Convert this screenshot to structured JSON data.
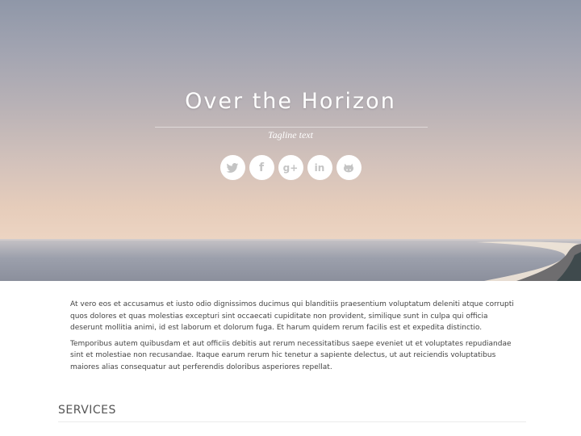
{
  "hero": {
    "title": "Over the Horizon",
    "tagline": "Tagline text",
    "social": [
      {
        "icon": "twitter-icon"
      },
      {
        "icon": "facebook-icon",
        "glyph": "f"
      },
      {
        "icon": "google-plus-icon",
        "glyph": "g+"
      },
      {
        "icon": "linkedin-icon",
        "glyph": "in"
      },
      {
        "icon": "github-icon"
      }
    ]
  },
  "content": {
    "paragraphs": [
      "At vero eos et accusamus et iusto odio dignissimos ducimus qui blanditiis praesentium voluptatum deleniti atque corrupti quos dolores et quas molestias excepturi sint occaecati cupiditate non provident, similique sunt in culpa qui officia deserunt mollitia animi, id est laborum et dolorum fuga. Et harum quidem rerum facilis est et expedita distinctio.",
      "Temporibus autem quibusdam et aut officiis debitis aut rerum necessitatibus saepe eveniet ut et voluptates repudiandae sint et molestiae non recusandae. Itaque earum rerum hic tenetur a sapiente delectus, ut aut reiciendis voluptatibus maiores alias consequatur aut perferendis doloribus asperiores repellat."
    ]
  },
  "services": {
    "heading": "SERVICES"
  },
  "colors": {
    "icon_gray": "#c4c4c4",
    "text": "#444444"
  }
}
